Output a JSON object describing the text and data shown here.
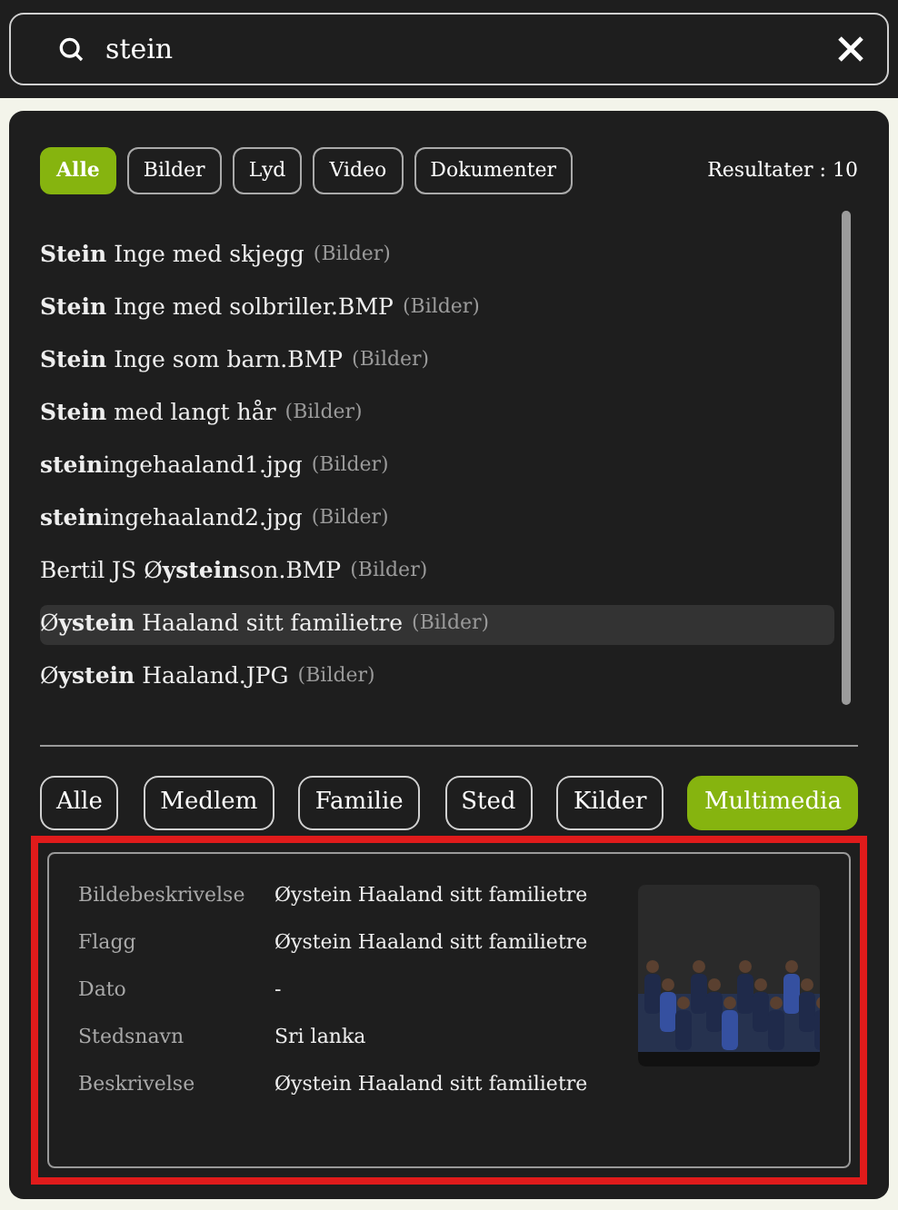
{
  "search": {
    "value": "stein"
  },
  "type_filters": [
    {
      "label": "Alle",
      "selected": true
    },
    {
      "label": "Bilder",
      "selected": false
    },
    {
      "label": "Lyd",
      "selected": false
    },
    {
      "label": "Video",
      "selected": false
    },
    {
      "label": "Dokumenter",
      "selected": false
    }
  ],
  "result_count": "Resultater : 10",
  "results": [
    {
      "title": "**Stein** Inge med skjegg",
      "type": "(Bilder)",
      "selected": false
    },
    {
      "title": "**Stein** Inge med solbriller.BMP",
      "type": "(Bilder)",
      "selected": false
    },
    {
      "title": "**Stein** Inge som barn.BMP",
      "type": "(Bilder)",
      "selected": false
    },
    {
      "title": "**Stein** med langt hår",
      "type": "(Bilder)",
      "selected": false
    },
    {
      "title": "**stein**ingehaaland1.jpg",
      "type": "(Bilder)",
      "selected": false
    },
    {
      "title": "**stein**ingehaaland2.jpg",
      "type": "(Bilder)",
      "selected": false
    },
    {
      "title": "Bertil JS Ø**ystein**son.BMP",
      "type": "(Bilder)",
      "selected": false
    },
    {
      "title": "Ø**ystein** Haaland sitt familietre",
      "type": "(Bilder)",
      "selected": true
    },
    {
      "title": "Ø**ystein** Haaland.JPG",
      "type": "(Bilder)",
      "selected": false
    }
  ],
  "category_tabs": [
    {
      "label": "Alle",
      "selected": false
    },
    {
      "label": "Medlem",
      "selected": false
    },
    {
      "label": "Familie",
      "selected": false
    },
    {
      "label": "Sted",
      "selected": false
    },
    {
      "label": "Kilder",
      "selected": false
    },
    {
      "label": "Multimedia",
      "selected": true
    }
  ],
  "details": {
    "fields": [
      {
        "label": "Bildebeskrivelse",
        "value": "Øystein Haaland sitt familietre"
      },
      {
        "label": "Flagg",
        "value": "Øystein Haaland sitt familietre"
      },
      {
        "label": "Dato",
        "value": "-"
      },
      {
        "label": "Stedsnavn",
        "value": "Sri lanka"
      },
      {
        "label": "Beskrivelse",
        "value": "Øystein Haaland sitt familietre"
      }
    ]
  }
}
